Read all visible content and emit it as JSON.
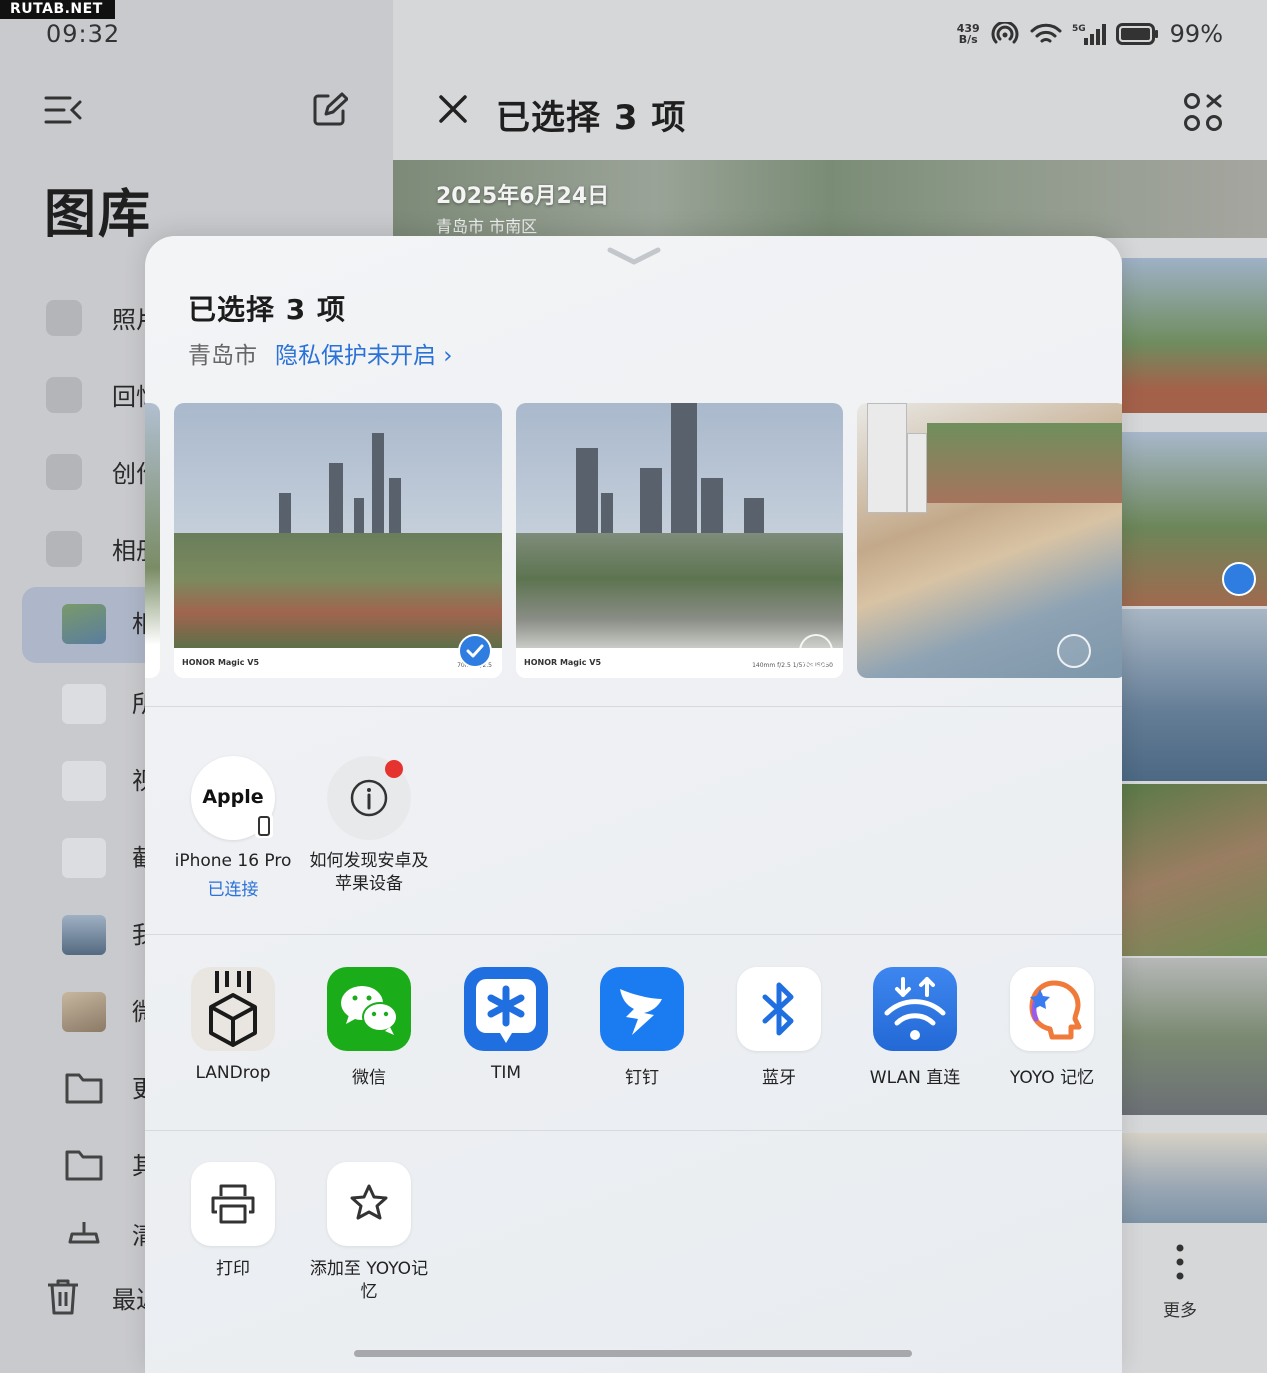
{
  "watermark": "RUTAB.NET",
  "status_bar": {
    "time": "09:32",
    "speed_top": "439",
    "speed_bottom": "B/s",
    "battery": "99%"
  },
  "left_panel": {
    "title": "图库",
    "items": [
      {
        "label": "照片"
      },
      {
        "label": "回忆"
      },
      {
        "label": "创作"
      },
      {
        "label": "相册"
      },
      {
        "label": "相机"
      },
      {
        "label": "所有"
      },
      {
        "label": "视频"
      },
      {
        "label": "截屏"
      },
      {
        "label": "我的"
      },
      {
        "label": "微信"
      },
      {
        "label": "更多"
      },
      {
        "label": "其他"
      },
      {
        "label": "清理"
      },
      {
        "label": "最近"
      }
    ]
  },
  "header": {
    "title": "已选择 3 项"
  },
  "background_strip": {
    "date": "2025年6月24日",
    "location": "青岛市 市南区"
  },
  "more_button": {
    "label": "更多"
  },
  "sheet": {
    "title": "已选择 3 项",
    "location": "青岛市",
    "privacy_link": "隐私保护未开启 ›",
    "photos": [
      {
        "brand": "HONOR Magic V5",
        "exif": "70mm f/2.5",
        "selected": true
      },
      {
        "brand": "HONOR Magic V5",
        "exif": "140mm f/2.5 1/570s ISO50",
        "selected": false
      },
      {
        "brand": "",
        "exif": "",
        "selected": false
      }
    ],
    "devices": [
      {
        "circle_text": "Apple",
        "name": "iPhone 16 Pro",
        "status": "已连接"
      },
      {
        "circle_text": "",
        "name": "如何发现安卓及苹果设备",
        "status": ""
      }
    ],
    "apps": [
      {
        "name": "LANDrop",
        "icon": "landrop-icon"
      },
      {
        "name": "微信",
        "icon": "wechat-icon"
      },
      {
        "name": "TIM",
        "icon": "tim-icon"
      },
      {
        "name": "钉钉",
        "icon": "dingtalk-icon"
      },
      {
        "name": "蓝牙",
        "icon": "bluetooth-icon"
      },
      {
        "name": "WLAN 直连",
        "icon": "wlan-direct-icon"
      },
      {
        "name": "YOYO 记忆",
        "icon": "yoyo-memory-icon"
      }
    ],
    "actions": [
      {
        "name": "打印",
        "icon": "printer-icon"
      },
      {
        "name": "添加至 YOYO记忆",
        "icon": "star-icon"
      }
    ]
  },
  "colors": {
    "accent": "#2a72d8",
    "wechat": "#1aad19",
    "tim": "#1f6fe0",
    "dingtalk": "#1b7cf2",
    "sheet_bg": "#eef0f3"
  }
}
